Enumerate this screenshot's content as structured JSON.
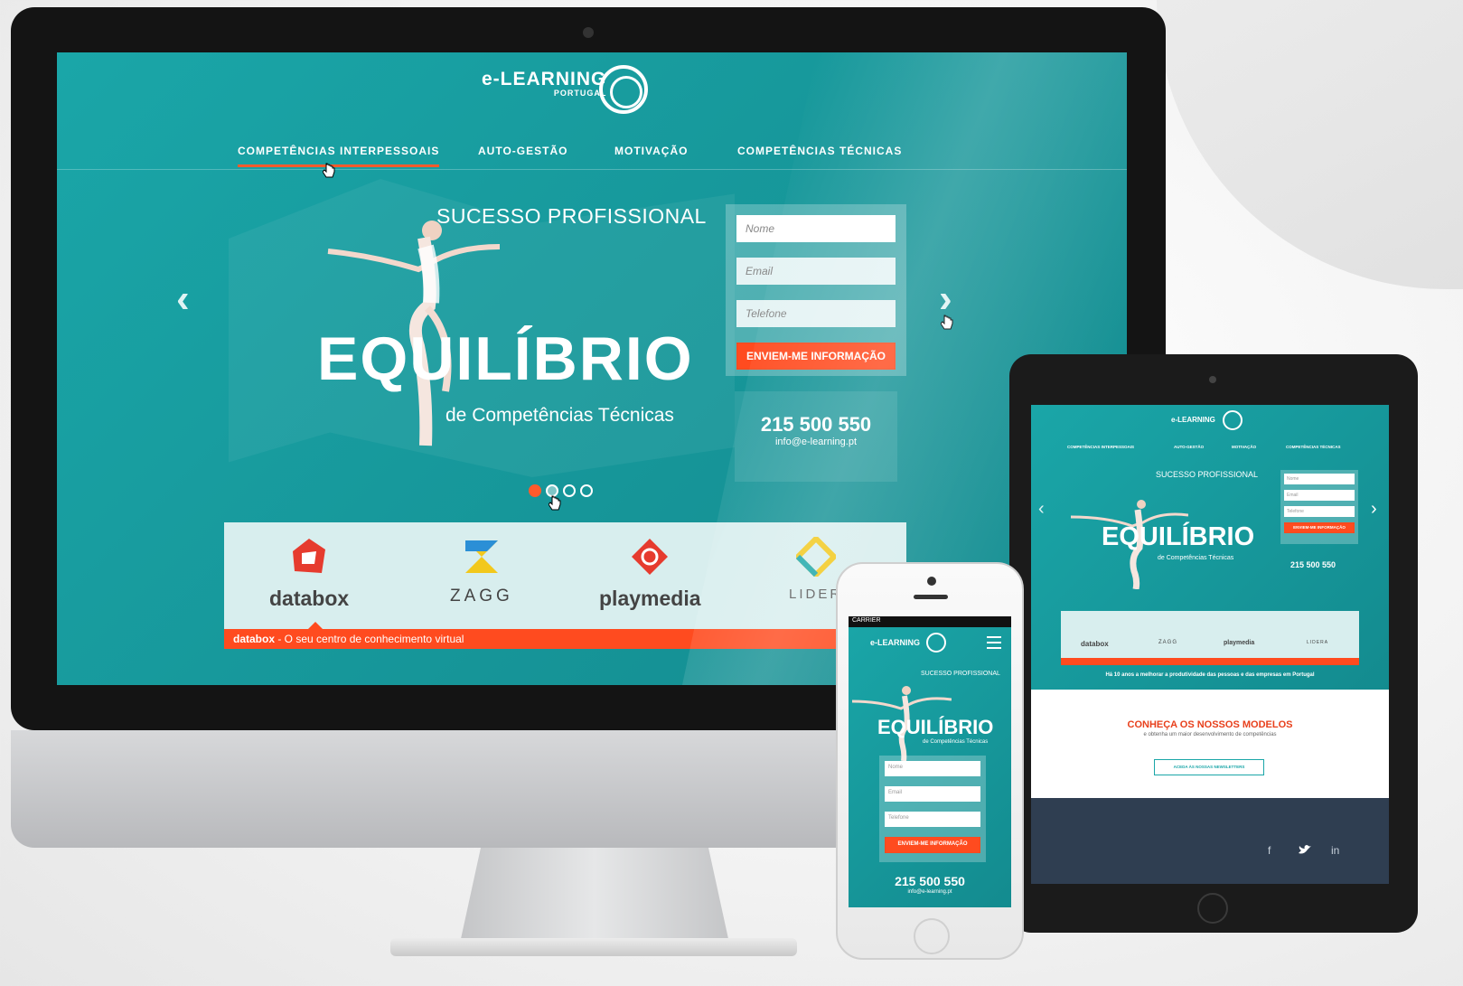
{
  "site": {
    "logo_name": "e-LEARNING",
    "logo_sub": "PORTUGAL",
    "nav": [
      "COMPETÊNCIAS INTERPESSOAIS",
      "AUTO-GESTÃO",
      "MOTIVAÇÃO",
      "COMPETÊNCIAS TÉCNICAS"
    ],
    "hero": {
      "kicker": "SUCESSO PROFISSIONAL",
      "title": "EQUILÍBRIO",
      "subtitle": "de Competências Técnicas"
    },
    "form": {
      "name_placeholder": "Nome",
      "email_placeholder": "Email",
      "phone_placeholder": "Telefone",
      "submit": "ENVIEM-ME INFORMAÇÃO"
    },
    "contact": {
      "phone": "215 500 550",
      "email": "info@e-learning.pt"
    },
    "partners": [
      "databox",
      "ZAGG",
      "playmedia",
      "LIDER"
    ],
    "partner_caption_brand": "databox",
    "partner_caption_text": " - O seu centro de conhecimento virtual"
  },
  "tablet": {
    "logo_name": "e-LEARNING",
    "nav": [
      "COMPETÊNCIAS INTERPESSOAIS",
      "AUTO-GESTÃO",
      "MOTIVAÇÃO",
      "COMPETÊNCIAS TÉCNICAS"
    ],
    "kicker": "SUCESSO PROFISSIONAL",
    "title": "EQUILÍBRIO",
    "subtitle": "de Competências Técnicas",
    "fields": [
      "Nome",
      "Email",
      "Telefone"
    ],
    "submit": "ENVIEM-ME INFORMAÇÃO",
    "phone": "215 500 550",
    "partners": [
      "databox",
      "ZAGG",
      "playmedia",
      "LIDERA"
    ],
    "tagline": "Há 10 anos a melhorar a produtividade das pessoas e das empresas em Portugal",
    "section_title": "CONHEÇA OS NOSSOS MODELOS",
    "section_sub": "e obtenha um maior desenvolvimento de competências",
    "newsletter_button": "ACEDA ÀS NOSSAS NEWSLETTERS",
    "social": [
      "f",
      "in"
    ]
  },
  "phone": {
    "carrier": "CARRIER",
    "logo_name": "e-LEARNING",
    "kicker": "SUCESSO PROFISSIONAL",
    "title": "EQUILÍBRIO",
    "subtitle": "de Competências Técnicas",
    "fields": [
      "Nome",
      "Email",
      "Telefone"
    ],
    "submit": "ENVIEM-ME INFORMAÇÃO",
    "phone": "215 500 550",
    "email": "info@e-learning.pt"
  },
  "colors": {
    "teal": "#1aa6a8",
    "accent": "#ff4b1f",
    "footer": "#2f3e51"
  },
  "icons": [
    "logo-ring-icon",
    "prev-arrow-icon",
    "next-arrow-icon",
    "hand-cursor-icon",
    "hamburger-menu-icon"
  ]
}
